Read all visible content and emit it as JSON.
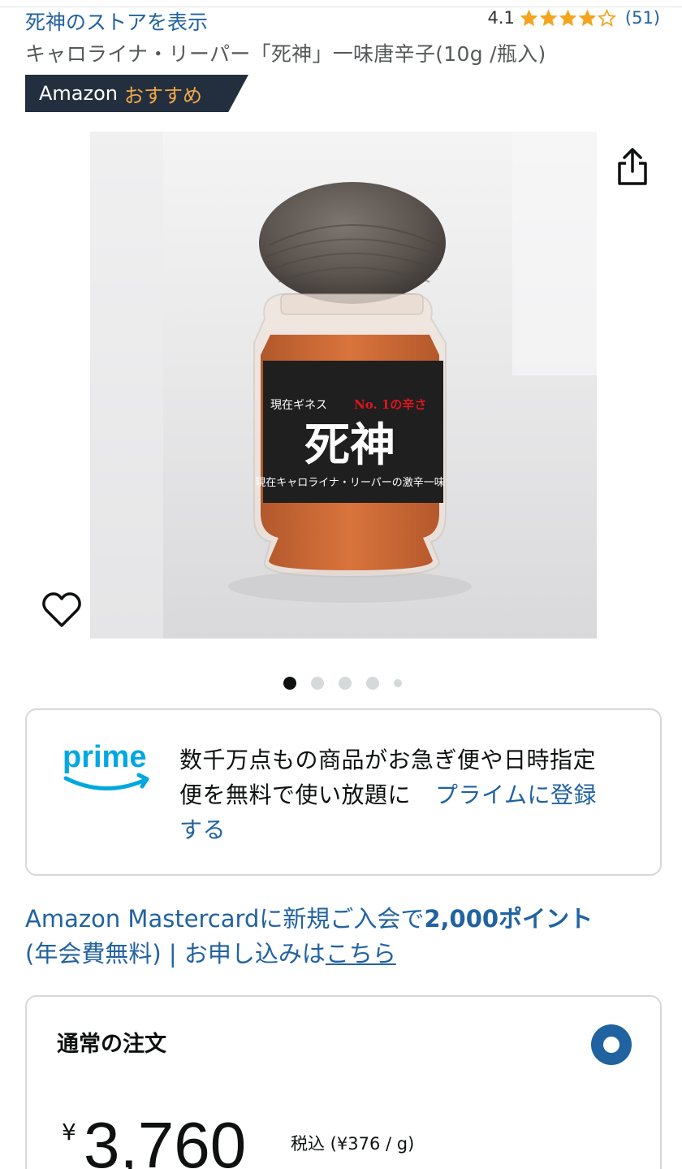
{
  "header": {
    "store_link": "死神のストアを表示",
    "rating_value": "4.1",
    "rating_count": "(51)",
    "stars": {
      "filled": 4,
      "outer": 5
    }
  },
  "product": {
    "title": "キャロライナ・リーパー「死神」一味唐辛子(10g /瓶入)",
    "badge": {
      "brand": "Amazon",
      "highlight": "おすすめ"
    },
    "image_label": {
      "top_left": "現在ギネス",
      "top_right": "No. 1の辛さ",
      "main": "死神",
      "bottom": "現在キャロライナ・リーパーの激辛一味"
    },
    "carousel": {
      "total": 5,
      "active_index": 0
    }
  },
  "icons": {
    "share": "share-icon",
    "wishlist": "heart-icon",
    "rating_star": "star-icon",
    "prime_logo": "prime-logo-icon"
  },
  "prime": {
    "logo_text": "prime",
    "text": "数千万点もの商品がお急ぎ便や日時指定便を無料で使い放題に",
    "link": "プライムに登録する"
  },
  "promo": {
    "text_before": "Amazon Mastercardに新規ご入会で",
    "points": "2,000ポイント",
    "text_after": "(年会費無料) | お申し込みは",
    "link": "こちら"
  },
  "order": {
    "title": "通常の注文",
    "currency": "¥",
    "price": "3,760",
    "tax_info": "税込 (¥376 / g)"
  },
  "colors": {
    "link": "#2162a1",
    "star": "#f4a41d",
    "badge_bg": "#232f3e",
    "badge_accent": "#f3a847",
    "prime_blue": "#00a8e1",
    "radio": "#2162a1"
  }
}
